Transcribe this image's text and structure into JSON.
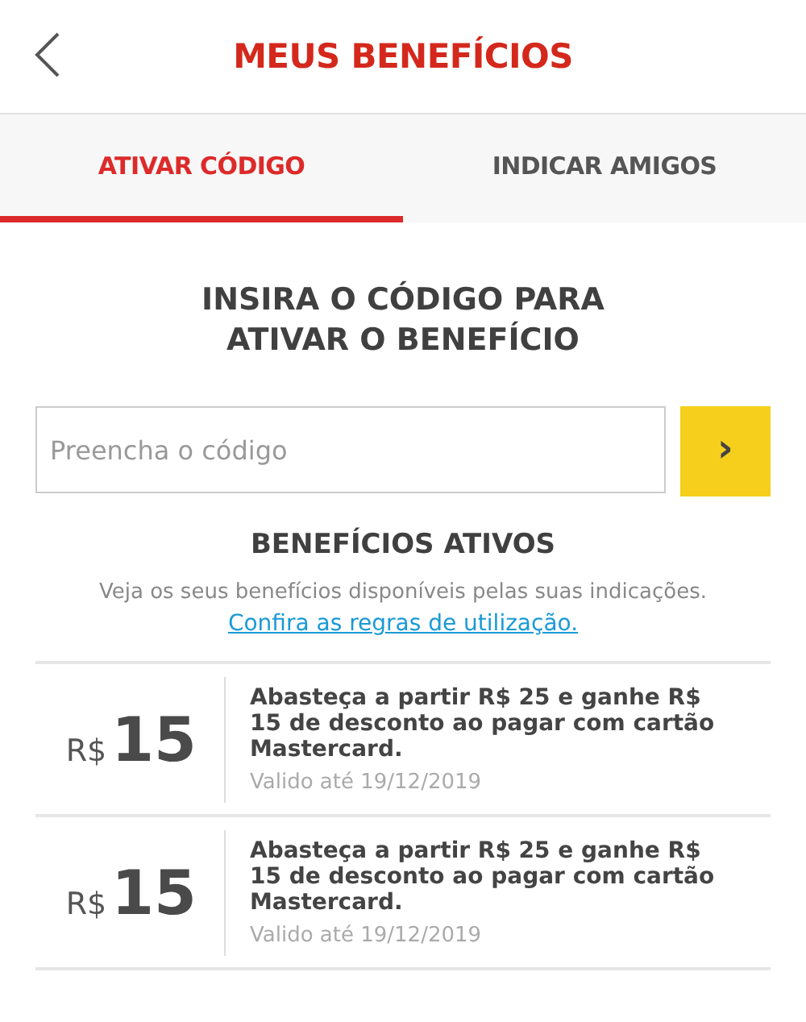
{
  "header": {
    "title": "MEUS BENEFÍCIOS"
  },
  "tabs": [
    {
      "label": "ATIVAR CÓDIGO",
      "selected": true
    },
    {
      "label": "INDICAR AMIGOS",
      "selected": false
    }
  ],
  "code_section": {
    "heading": "INSIRA O CÓDIGO PARA ATIVAR O BENEFÍCIO",
    "placeholder": "Preencha o código",
    "submit": "›"
  },
  "benefits": {
    "title": "BENEFÍCIOS ATIVOS",
    "subtitle": "Veja os seus benefícios disponíveis pelas suas indicações.",
    "link": "Confira as regras de utilização.",
    "items": [
      {
        "currency": "R$",
        "amount": "15",
        "description": "Abasteça a partir R$ 25 e ganhe R$ 15 de desconto ao pagar com cartão Mastercard.",
        "validity": "Valido até 19/12/2019"
      },
      {
        "currency": "R$",
        "amount": "15",
        "description": "Abasteça a partir R$ 25 e ganhe R$ 15 de desconto ao pagar com cartão Mastercard.",
        "validity": "Valido até 19/12/2019"
      }
    ]
  }
}
